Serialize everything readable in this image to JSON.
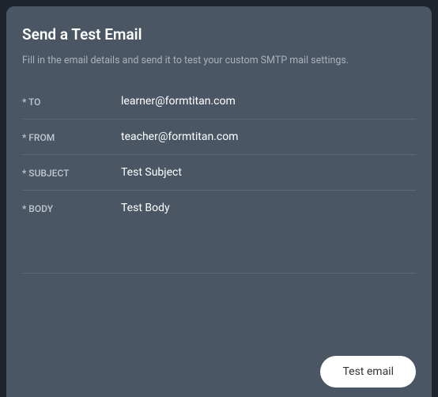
{
  "header": {
    "title": "Send a Test Email",
    "subtitle": "Fill in the email details and send it to test your custom SMTP mail settings."
  },
  "fields": {
    "to": {
      "label": "* TO",
      "value": "learner@formtitan.com"
    },
    "from": {
      "label": "* FROM",
      "value": "teacher@formtitan.com"
    },
    "subject": {
      "label": "* SUBJECT",
      "value": "Test Subject"
    },
    "body": {
      "label": "* BODY",
      "value": "Test Body"
    }
  },
  "actions": {
    "test_email_label": "Test email"
  }
}
